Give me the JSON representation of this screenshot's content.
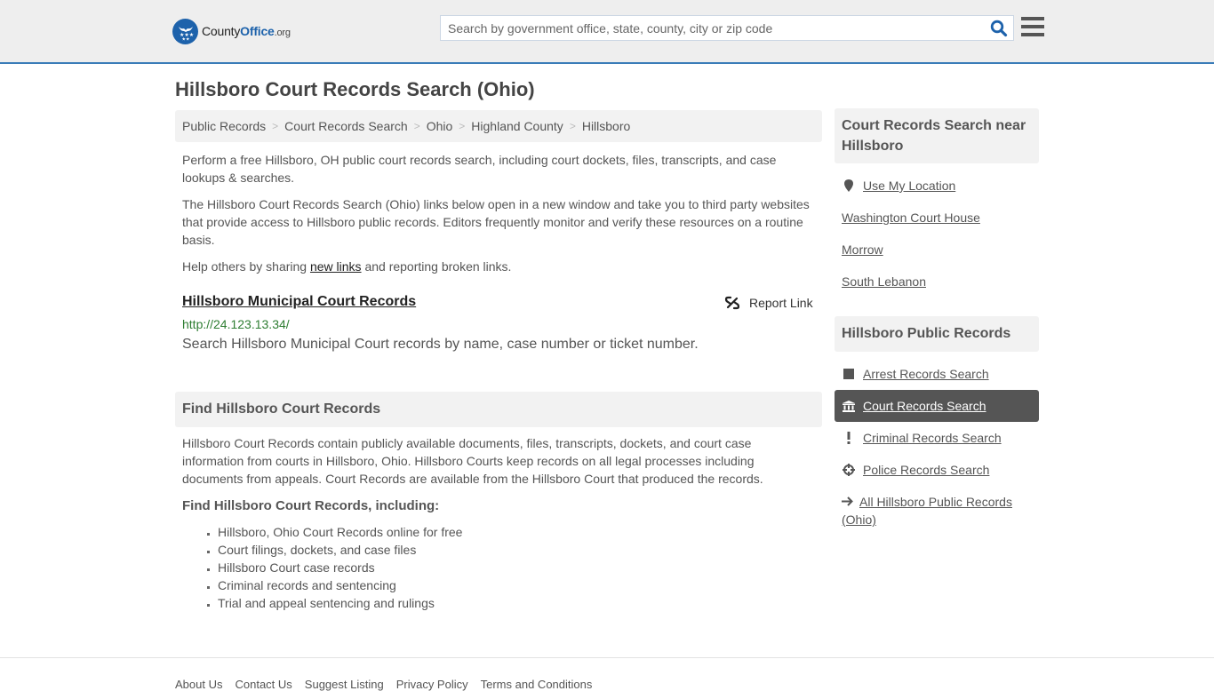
{
  "header": {
    "logo": {
      "name_part1": "County",
      "name_part2": "Office",
      "tld": ".org"
    },
    "search": {
      "placeholder": "Search by government office, state, county, city or zip code",
      "value": ""
    },
    "colors": {
      "brand_blue": "#1d62ab",
      "header_border": "#3a7cb8",
      "header_bg": "#eeeeee"
    }
  },
  "page": {
    "title": "Hillsboro Court Records Search (Ohio)",
    "breadcrumb": [
      {
        "label": "Public Records"
      },
      {
        "label": "Court Records Search"
      },
      {
        "label": "Ohio"
      },
      {
        "label": "Highland County"
      },
      {
        "label": "Hillsboro"
      }
    ],
    "breadcrumb_separator": ">",
    "intro": {
      "p1": "Perform a free Hillsboro, OH public court records search, including court dockets, files, transcripts, and case lookups & searches.",
      "p2": "The Hillsboro Court Records Search (Ohio) links below open in a new window and take you to third party websites that provide access to Hillsboro public records. Editors frequently monitor and verify these resources on a routine basis.",
      "p3_before": "Help others by sharing ",
      "p3_link": "new links",
      "p3_after": " and reporting broken links."
    },
    "results": [
      {
        "title": "Hillsboro Municipal Court Records",
        "url": "http://24.123.13.34/",
        "description": "Search Hillsboro Municipal Court records by name, case number or ticket number.",
        "report_label": "Report Link"
      }
    ],
    "find_section": {
      "heading": "Find Hillsboro Court Records",
      "body": "Hillsboro Court Records contain publicly available documents, files, transcripts, dockets, and court case information from courts in Hillsboro, Ohio. Hillsboro Courts keep records on all legal processes including documents from appeals. Court Records are available from the Hillsboro Court that produced the records.",
      "subheading": "Find Hillsboro Court Records, including:",
      "items": [
        "Hillsboro, Ohio Court Records online for free",
        "Court filings, dockets, and case files",
        "Hillsboro Court case records",
        "Criminal records and sentencing",
        "Trial and appeal sentencing and rulings"
      ]
    }
  },
  "sidebar": {
    "nearby": {
      "heading": "Court Records Search near Hillsboro",
      "use_location": {
        "label": "Use My Location",
        "icon": "map-marker-icon"
      },
      "places": [
        "Washington Court House",
        "Morrow",
        "South Lebanon"
      ]
    },
    "public_records": {
      "heading": "Hillsboro Public Records",
      "items": [
        {
          "label": "Arrest Records Search",
          "icon": "square-icon",
          "active": false
        },
        {
          "label": "Court Records Search",
          "icon": "courthouse-icon",
          "active": true
        },
        {
          "label": "Criminal Records Search",
          "icon": "exclamation-icon",
          "active": false
        },
        {
          "label": "Police Records Search",
          "icon": "crosshair-icon",
          "active": false
        },
        {
          "label": "All Hillsboro Public Records (Ohio)",
          "icon": "arrow-right-icon",
          "active": false
        }
      ]
    }
  },
  "footer": {
    "links": [
      "About Us",
      "Contact Us",
      "Suggest Listing",
      "Privacy Policy",
      "Terms and Conditions"
    ]
  }
}
